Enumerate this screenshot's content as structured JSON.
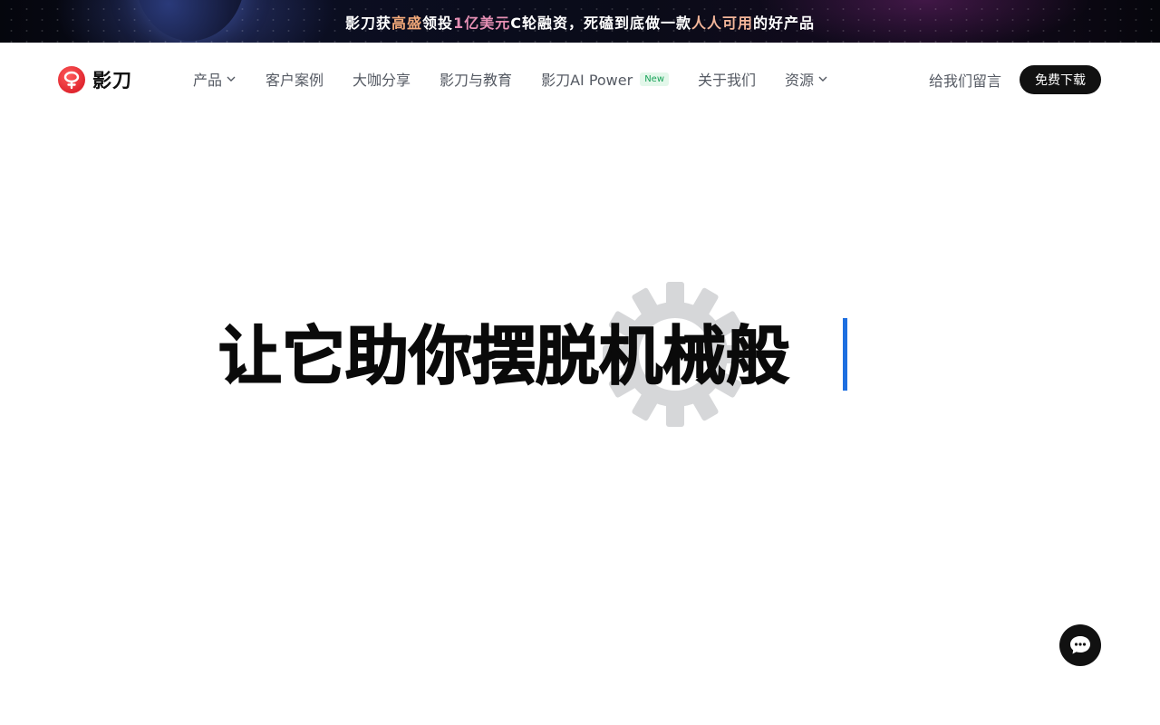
{
  "promo": {
    "part1": "影刀获",
    "hl1": "高盛",
    "part2": "领投",
    "hl2": "1亿美元",
    "part3": "C轮融资，死磕到底做一款",
    "hl3": "人人可用",
    "part4": "的好产品"
  },
  "header": {
    "logo_text": "影刀",
    "nav": [
      {
        "label": "产品",
        "has_dropdown": true
      },
      {
        "label": "客户案例"
      },
      {
        "label": "大咖分享"
      },
      {
        "label": "影刀与教育"
      },
      {
        "label": "影刀AI Power",
        "badge": "New"
      },
      {
        "label": "关于我们"
      },
      {
        "label": "资源",
        "has_dropdown": true
      }
    ],
    "leave_message": "给我们留言",
    "download": "免费下载"
  },
  "hero": {
    "title": "让它助你摆脱机械般"
  },
  "icons": {
    "logo": "yingdao-logo-icon",
    "gear": "gear-icon",
    "chat": "chat-bubble-icon",
    "chevron": "chevron-down-icon"
  },
  "colors": {
    "caret": "#1e6fe0",
    "download_button": "#111111",
    "new_badge": "#1aa35a"
  }
}
